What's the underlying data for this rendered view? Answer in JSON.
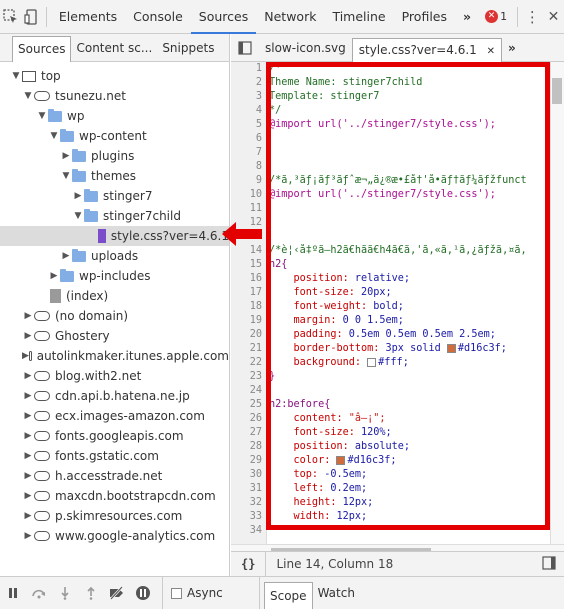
{
  "toolbar": {
    "tabs": [
      "Elements",
      "Console",
      "Sources",
      "Network",
      "Timeline",
      "Profiles"
    ],
    "more_label": "»",
    "error_count": "1",
    "kebab_label": "⋮",
    "close_label": "✕"
  },
  "left": {
    "subtabs": [
      "Sources",
      "Content sc...",
      "Snippets"
    ],
    "kebab_label": "⋮",
    "tree": [
      {
        "label": "top",
        "icon": "frame-icon"
      },
      {
        "label": "tsunezu.net",
        "icon": "cloud-icon"
      },
      {
        "label": "wp",
        "icon": "folder-icon"
      },
      {
        "label": "wp-content",
        "icon": "folder-icon"
      },
      {
        "label": "plugins",
        "icon": "folder-icon"
      },
      {
        "label": "themes",
        "icon": "folder-icon"
      },
      {
        "label": "stinger7",
        "icon": "folder-icon"
      },
      {
        "label": "stinger7child",
        "icon": "folder-icon"
      },
      {
        "label": "style.css?ver=4.6.1",
        "icon": "file-icon"
      },
      {
        "label": "uploads",
        "icon": "folder-icon"
      },
      {
        "label": "wp-includes",
        "icon": "folder-icon"
      },
      {
        "label": "(index)",
        "icon": "file-icon"
      },
      {
        "label": "(no domain)",
        "icon": "cloud-icon"
      },
      {
        "label": "Ghostery",
        "icon": "cloud-icon"
      },
      {
        "label": "autolinkmaker.itunes.apple.com",
        "icon": "cloud-icon"
      },
      {
        "label": "blog.with2.net",
        "icon": "cloud-icon"
      },
      {
        "label": "cdn.api.b.hatena.ne.jp",
        "icon": "cloud-icon"
      },
      {
        "label": "ecx.images-amazon.com",
        "icon": "cloud-icon"
      },
      {
        "label": "fonts.googleapis.com",
        "icon": "cloud-icon"
      },
      {
        "label": "fonts.gstatic.com",
        "icon": "cloud-icon"
      },
      {
        "label": "h.accesstrade.net",
        "icon": "cloud-icon"
      },
      {
        "label": "maxcdn.bootstrapcdn.com",
        "icon": "cloud-icon"
      },
      {
        "label": "p.skimresources.com",
        "icon": "cloud-icon"
      },
      {
        "label": "www.google-analytics.com",
        "icon": "cloud-icon"
      }
    ]
  },
  "editor": {
    "tabs": [
      "slow-icon.svg",
      "style.css?ver=4.6.1"
    ],
    "close_label": "✕",
    "more_label": "»",
    "lines": [
      "/*",
      "Theme Name: stinger7child",
      "Template: stinger7",
      "*/",
      "@import url('../stinger7/style.css');",
      "",
      "",
      "",
      "/*ã,³ãƒ¡ãƒ³ãƒˆæ¬„ä¿®æ•£å†'å•ãƒ†ãƒ¼ãƒžfunct",
      "@import url('../stinger7/style.css');",
      "",
      "",
      "",
      "/*è¦‹å‡ºã—h2ã€hãã€h4ã€ã,'ã,«ã,¹ã,¿ãƒžã,¤ã,",
      "h2{",
      "    position: relative;",
      "    font-size: 20px;",
      "    font-weight: bold;",
      "    margin: 0 0 1.5em;",
      "    padding: 0.5em 0.5em 0.5em 2.5em;",
      "    border-bottom: 3px solid #d16c3f;",
      "    background: #fff;",
      "}",
      "",
      "h2:before{",
      "    content: \"â–¡\";",
      "    font-size: 120%;",
      "    position: absolute;",
      "    color: #d16c3f;",
      "    top: -0.5em;",
      "    left: 0.2em;",
      "    height: 12px;",
      "    width: 12px;"
    ],
    "line_numbers": [
      "1",
      "2",
      "3",
      "4",
      "5",
      "6",
      "7",
      "8",
      "9",
      "10",
      "11",
      "12",
      "13",
      "14",
      "15",
      "16",
      "17",
      "18",
      "19",
      "20",
      "21",
      "22",
      "23",
      "24",
      "25",
      "26",
      "27",
      "28",
      "29",
      "30",
      "31",
      "32",
      "33",
      "34"
    ],
    "accent_color": "#d16c3f",
    "white_color": "#fff"
  },
  "status": {
    "braces": "{}",
    "cursor": "Line 14, Column 18"
  },
  "bottom": {
    "async_label": "Async",
    "tabs": [
      "Scope",
      "Watch"
    ]
  },
  "annotation": {
    "box_color": "#e30000"
  }
}
